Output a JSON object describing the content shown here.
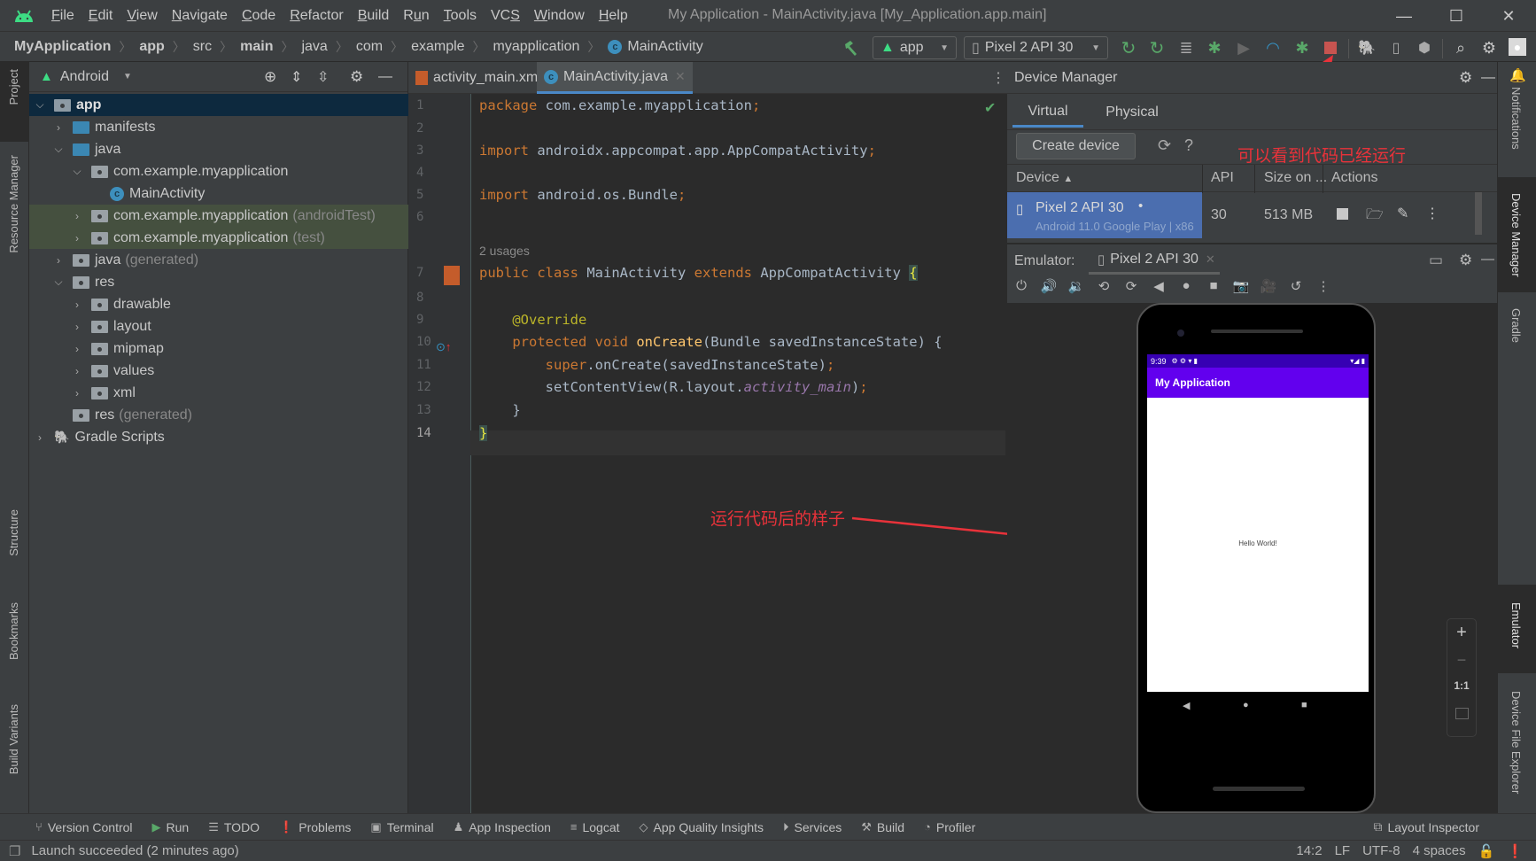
{
  "menu": {
    "items": [
      "File",
      "Edit",
      "View",
      "Navigate",
      "Code",
      "Refactor",
      "Build",
      "Run",
      "Tools",
      "VCS",
      "Window",
      "Help"
    ],
    "mnemonics": [
      "F",
      "E",
      "V",
      "N",
      "C",
      "R",
      "B",
      "u",
      "T",
      "S",
      "W",
      "H"
    ]
  },
  "window": {
    "title": "My Application - MainActivity.java [My_Application.app.main]"
  },
  "breadcrumb": [
    "MyApplication",
    "app",
    "src",
    "main",
    "java",
    "com",
    "example",
    "myapplication",
    "MainActivity"
  ],
  "toolbar": {
    "run_config": "app",
    "device": "Pixel 2 API 30",
    "icons": [
      "hammer-icon",
      "apply-changes-restart-icon",
      "apply-code-changes-icon",
      "sync-icon",
      "debug-icon",
      "coverage-icon",
      "profile-icon",
      "attach-debugger-icon",
      "stop-icon",
      "gradle-sync-icon",
      "avd-manager-icon",
      "sdk-manager-icon",
      "search-icon",
      "settings-icon",
      "avatar"
    ],
    "stop_color": "#c75450"
  },
  "left_strip": {
    "tabs": [
      "Project",
      "Resource Manager",
      "Structure",
      "Bookmarks",
      "Build Variants"
    ]
  },
  "right_strip": {
    "tabs": [
      "Notifications",
      "Device Manager",
      "Gradle",
      "Emulator",
      "Device File Explorer"
    ]
  },
  "project": {
    "view": "Android",
    "tree": [
      {
        "label": "app",
        "suffix": "",
        "level": 0,
        "expanded": true,
        "icon": "module",
        "selected": true
      },
      {
        "label": "manifests",
        "suffix": "",
        "level": 1,
        "expanded": false,
        "icon": "folder-blue"
      },
      {
        "label": "java",
        "suffix": "",
        "level": 1,
        "expanded": true,
        "icon": "folder-blue"
      },
      {
        "label": "com.example.myapplication",
        "suffix": "",
        "level": 2,
        "expanded": true,
        "icon": "package"
      },
      {
        "label": "MainActivity",
        "suffix": "",
        "level": 3,
        "expanded": null,
        "icon": "class"
      },
      {
        "label": "com.example.myapplication",
        "suffix": "(androidTest)",
        "level": 2,
        "expanded": false,
        "icon": "package",
        "highlight": true
      },
      {
        "label": "com.example.myapplication",
        "suffix": "(test)",
        "level": 2,
        "expanded": false,
        "icon": "package",
        "highlight": true
      },
      {
        "label": "java",
        "suffix": "(generated)",
        "level": 1,
        "expanded": false,
        "icon": "folder-generated"
      },
      {
        "label": "res",
        "suffix": "",
        "level": 1,
        "expanded": true,
        "icon": "folder-res"
      },
      {
        "label": "drawable",
        "suffix": "",
        "level": 2,
        "expanded": false,
        "icon": "package"
      },
      {
        "label": "layout",
        "suffix": "",
        "level": 2,
        "expanded": false,
        "icon": "package"
      },
      {
        "label": "mipmap",
        "suffix": "",
        "level": 2,
        "expanded": false,
        "icon": "package"
      },
      {
        "label": "values",
        "suffix": "",
        "level": 2,
        "expanded": false,
        "icon": "package"
      },
      {
        "label": "xml",
        "suffix": "",
        "level": 2,
        "expanded": false,
        "icon": "package"
      },
      {
        "label": "res",
        "suffix": "(generated)",
        "level": 1,
        "expanded": null,
        "icon": "folder-res"
      },
      {
        "label": "Gradle Scripts",
        "suffix": "",
        "level": 0,
        "expanded": false,
        "icon": "gradle"
      }
    ]
  },
  "editor": {
    "tabs": [
      {
        "label": "activity_main.xml",
        "active": false
      },
      {
        "label": "MainActivity.java",
        "active": true
      }
    ],
    "usages_hint": "2 usages",
    "lines": [
      {
        "n": "1",
        "tokens": [
          [
            "kw",
            "package "
          ],
          [
            "",
            "com.example.myapplication"
          ],
          [
            "kw",
            ";"
          ]
        ]
      },
      {
        "n": "2",
        "tokens": []
      },
      {
        "n": "3",
        "tokens": [
          [
            "kw",
            "import "
          ],
          [
            "",
            "androidx.appcompat.app.AppCompatActivity"
          ],
          [
            "kw",
            ";"
          ]
        ]
      },
      {
        "n": "4",
        "tokens": []
      },
      {
        "n": "5",
        "tokens": [
          [
            "kw",
            "import "
          ],
          [
            "",
            "android.os.Bundle"
          ],
          [
            "kw",
            ";"
          ]
        ]
      },
      {
        "n": "6",
        "tokens": []
      },
      {
        "n": "7",
        "tokens": [
          [
            "kw",
            "public class "
          ],
          [
            "",
            "MainActivity "
          ],
          [
            "kw",
            "extends "
          ],
          [
            "",
            "AppCompatActivity "
          ],
          [
            "br",
            "{"
          ]
        ]
      },
      {
        "n": "8",
        "tokens": []
      },
      {
        "n": "9",
        "tokens": [
          [
            "",
            "    "
          ],
          [
            "an",
            "@Override"
          ]
        ]
      },
      {
        "n": "10",
        "tokens": [
          [
            "",
            "    "
          ],
          [
            "kw",
            "protected void "
          ],
          [
            "fn",
            "onCreate"
          ],
          [
            "",
            "(Bundle savedInstanceState) {"
          ]
        ]
      },
      {
        "n": "11",
        "tokens": [
          [
            "",
            "        "
          ],
          [
            "kw",
            "super"
          ],
          [
            "",
            ".onCreate(savedInstanceState)"
          ],
          [
            "kw",
            ";"
          ]
        ]
      },
      {
        "n": "12",
        "tokens": [
          [
            "",
            "        setContentView(R.layout."
          ],
          [
            "it",
            "activity_main"
          ],
          [
            "",
            ")"
          ],
          [
            "kw",
            ";"
          ]
        ]
      },
      {
        "n": "13",
        "tokens": [
          [
            "",
            "    }"
          ]
        ]
      },
      {
        "n": "14",
        "tokens": [
          [
            "br",
            "}"
          ]
        ]
      }
    ]
  },
  "device_manager": {
    "title": "Device Manager",
    "tabs": [
      "Virtual",
      "Physical"
    ],
    "active_tab": "Virtual",
    "create_button": "Create device",
    "columns": [
      "Device",
      "API",
      "Size on ...",
      "Actions"
    ],
    "rows": [
      {
        "name": "Pixel 2 API 30",
        "detail": "Android 11.0 Google Play | x86",
        "api": "30",
        "size": "513 MB",
        "running": true
      }
    ]
  },
  "emulator": {
    "label": "Emulator:",
    "tab": "Pixel 2 API 30",
    "controls": [
      "power-icon",
      "volume-up-icon",
      "volume-down-icon",
      "rotate-left-icon",
      "rotate-right-icon",
      "back-icon",
      "home-icon",
      "overview-icon",
      "screenshot-icon",
      "record-icon",
      "snapshot-icon",
      "more-icon"
    ],
    "zoom_controls": [
      "+",
      "−",
      "1:1"
    ],
    "phone": {
      "time": "9:39",
      "app_title": "My Application",
      "content_text": "Hello World!",
      "appbar_color": "#6200ee",
      "statusbar_color": "#3700b3"
    }
  },
  "annotations": {
    "code_running": "可以看到代码已经运行",
    "after_run": "运行代码后的样子",
    "color": "#e8323a"
  },
  "bottom_tools": [
    "Version Control",
    "Run",
    "TODO",
    "Problems",
    "Terminal",
    "App Inspection",
    "Logcat",
    "App Quality Insights",
    "Services",
    "Build",
    "Profiler"
  ],
  "layout_inspector": "Layout Inspector",
  "status": {
    "message": "Launch succeeded (2 minutes ago)",
    "position": "14:2",
    "line_sep": "LF",
    "encoding": "UTF-8",
    "indent": "4 spaces"
  }
}
